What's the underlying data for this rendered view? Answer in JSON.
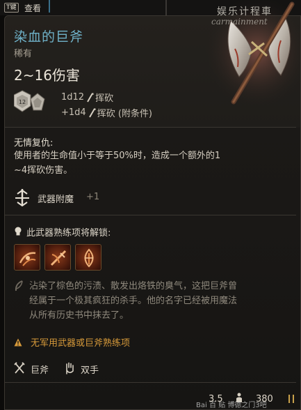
{
  "topbar": {
    "key_badge": "T键",
    "view_label": "查看"
  },
  "watermark": {
    "line1": "娱乐计程車",
    "line2": "carmainment"
  },
  "item": {
    "name": "染血的巨斧",
    "rarity": "稀有",
    "damage": "2~16伤害",
    "dice_badge": "12",
    "damage_rows": [
      {
        "dice": "1d12",
        "type": "挥砍"
      },
      {
        "dice": "+1d4",
        "type": "挥砍 (附条件)"
      }
    ]
  },
  "passive": {
    "title": "无情复仇:",
    "text_line1": "使用者的生命值小于等于50%时，造成一个额外的1",
    "text_line2": "~4挥砍伤害。"
  },
  "enchant": {
    "label": "武器附魔",
    "bonus": "+1"
  },
  "proficiency": {
    "unlock_label": "此武器熟练项将解锁:",
    "actions": [
      "action-1",
      "action-2",
      "action-3"
    ]
  },
  "lore": {
    "line1": "沾染了棕色的污渍、散发出烙铁的臭气，这把巨斧曾",
    "line2": "经属于一个极其疯狂的杀手。他的名字已经被用魔法",
    "line3": "从所有历史书中抹去了。"
  },
  "warning": {
    "text": "无军用武器或巨斧熟练项"
  },
  "tags": [
    {
      "icon": "crossed-axes-icon",
      "label": "巨斧"
    },
    {
      "icon": "hand-icon",
      "label": "双手"
    }
  ],
  "footer": {
    "price": "3.5",
    "weight": "380",
    "baidu_mark": "Bai 百 贴",
    "forum_mark": "博德之门3吧"
  },
  "colors": {
    "title": "#6fb1c8",
    "warning": "#d79a3a",
    "lore": "#8f897d"
  }
}
